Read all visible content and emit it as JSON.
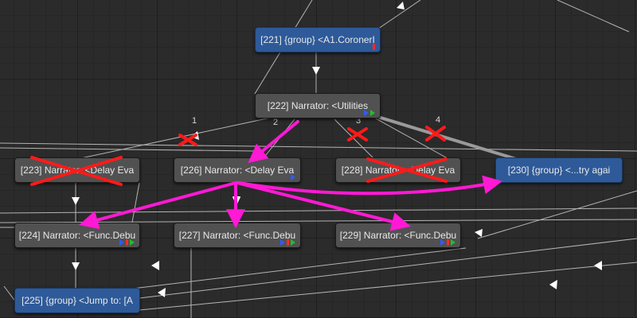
{
  "graph": {
    "nodes": {
      "n221": {
        "label": "[221] {group} <A1.CoronerI"
      },
      "n222": {
        "label": "[222] Narrator: <Utilities"
      },
      "n223": {
        "label": "[223] Narrator: <Delay Eva"
      },
      "n226": {
        "label": "[226] Narrator: <Delay Eva"
      },
      "n228": {
        "label": "[228] Narrator: <Delay Eva"
      },
      "n230": {
        "label": "[230] {group} <...try agai"
      },
      "n224": {
        "label": "[224] Narrator: <Func.Debu"
      },
      "n227": {
        "label": "[227] Narrator: <Func.Debu"
      },
      "n229": {
        "label": "[229] Narrator: <Func.Debu"
      },
      "n225": {
        "label": "[225] {group} <Jump to: [A"
      }
    },
    "choice_labels": [
      "1",
      "2",
      "3",
      "4"
    ]
  },
  "colors": {
    "background": "#2b2b2b",
    "node_gray": "#515151",
    "node_blue": "#2e5a99",
    "annotation_magenta": "#ff19d4",
    "annotation_red": "#ff1a1a",
    "port_blue": "#2f5bff",
    "port_green": "#1fbf2a",
    "port_red": "#ff2a2a"
  }
}
